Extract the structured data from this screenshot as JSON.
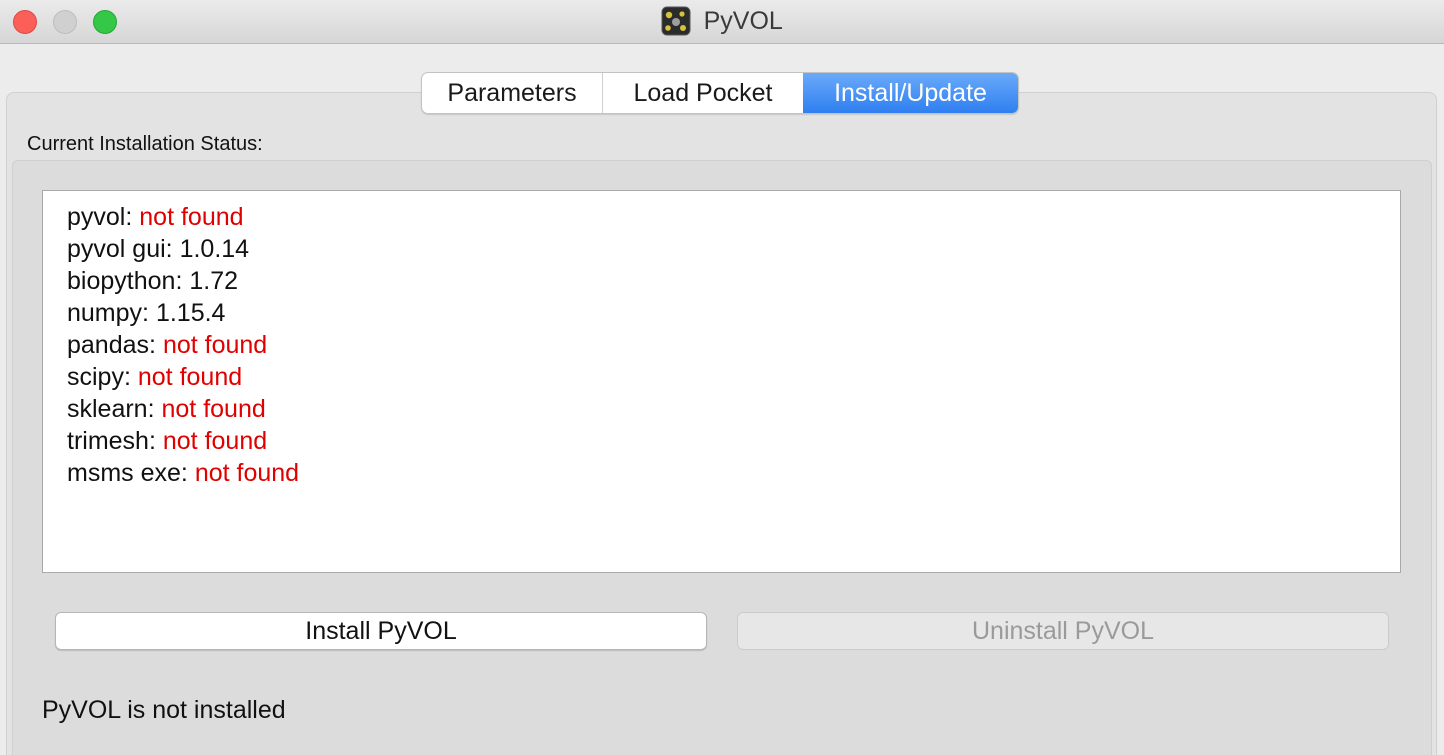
{
  "window": {
    "title": "PyVOL",
    "icon": "pyvol-app-icon"
  },
  "tabs": [
    {
      "label": "Parameters",
      "selected": false
    },
    {
      "label": "Load Pocket",
      "selected": false
    },
    {
      "label": "Install/Update",
      "selected": true
    }
  ],
  "install_panel": {
    "section_label": "Current Installation Status:",
    "status": [
      {
        "name": "pyvol",
        "value": "not found",
        "found": false
      },
      {
        "name": "pyvol gui",
        "value": "1.0.14",
        "found": true
      },
      {
        "name": "biopython",
        "value": "1.72",
        "found": true
      },
      {
        "name": "numpy",
        "value": "1.15.4",
        "found": true
      },
      {
        "name": "pandas",
        "value": "not found",
        "found": false
      },
      {
        "name": "scipy",
        "value": "not found",
        "found": false
      },
      {
        "name": "sklearn",
        "value": "not found",
        "found": false
      },
      {
        "name": "trimesh",
        "value": "not found",
        "found": false
      },
      {
        "name": "msms exe",
        "value": "not found",
        "found": false
      }
    ],
    "install_button": "Install PyVOL",
    "uninstall_button": "Uninstall PyVOL",
    "uninstall_enabled": false,
    "footer_status": "PyVOL is not installed"
  },
  "colors": {
    "not_found": "#e00000",
    "tab_selected": "#2f7ff1"
  }
}
